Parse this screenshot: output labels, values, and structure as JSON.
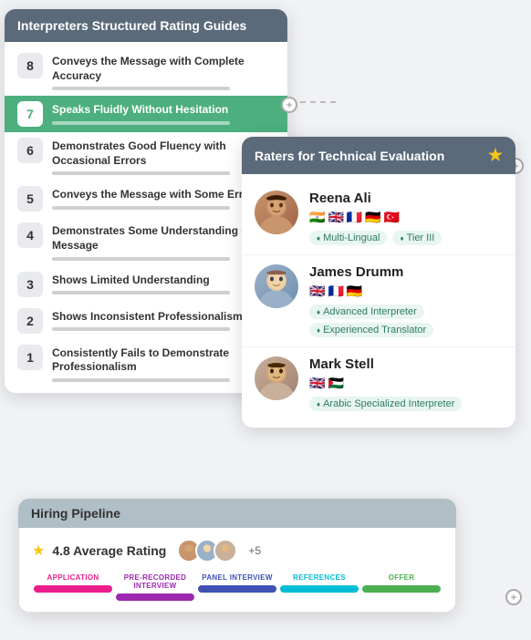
{
  "rating_guide": {
    "title": "Interpreters Structured Rating Guides",
    "items": [
      {
        "num": "8",
        "label": "Conveys the Message with Complete Accuracy",
        "active": false
      },
      {
        "num": "7",
        "label": "Speaks Fluidly Without Hesitation",
        "active": true
      },
      {
        "num": "6",
        "label": "Demonstrates Good Fluency with Occasional Errors",
        "active": false
      },
      {
        "num": "5",
        "label": "Conveys the Message with Some Errors",
        "active": false
      },
      {
        "num": "4",
        "label": "Demonstrates Some Understanding of the Message",
        "active": false
      },
      {
        "num": "3",
        "label": "Shows Limited Understanding",
        "active": false
      },
      {
        "num": "2",
        "label": "Shows Inconsistent Professionalism",
        "active": false
      },
      {
        "num": "1",
        "label": "Consistently Fails to Demonstrate Professionalism",
        "active": false
      }
    ]
  },
  "raters": {
    "title": "Raters for Technical Evaluation",
    "items": [
      {
        "name": "Reena Ali",
        "flags": [
          "🇮🇳",
          "🇬🇧",
          "🇫🇷",
          "🇩🇪",
          "🇹🇷"
        ],
        "tags": [
          {
            "label": "Multi-Lingual",
            "style": "green"
          },
          {
            "label": "Tier III",
            "style": "green"
          }
        ],
        "avatar_color": "#c8956c"
      },
      {
        "name": "James Drumm",
        "flags": [
          "🇬🇧",
          "🇫🇷",
          "🇩🇪"
        ],
        "tags": [
          {
            "label": "Advanced Interpreter",
            "style": "green"
          },
          {
            "label": "Experienced Translator",
            "style": "green"
          }
        ],
        "avatar_color": "#9ab0c8"
      },
      {
        "name": "Mark Stell",
        "flags": [
          "🇬🇧",
          "🇵🇸"
        ],
        "tags": [
          {
            "label": "Arabic Specialized Interpreter",
            "style": "green"
          }
        ],
        "avatar_color": "#c8b09a"
      }
    ]
  },
  "pipeline": {
    "title": "Hiring Pipeline",
    "rating": "4.8 Average Rating",
    "plus_count": "+5",
    "stages": [
      {
        "label": "APPLICATION",
        "style": "stage-app"
      },
      {
        "label": "PRE-RECORDED INTERVIEW",
        "style": "stage-pre"
      },
      {
        "label": "PANEL INTERVIEW",
        "style": "stage-panel"
      },
      {
        "label": "REFERENCES",
        "style": "stage-ref"
      },
      {
        "label": "OFFER",
        "style": "stage-offer"
      }
    ]
  }
}
